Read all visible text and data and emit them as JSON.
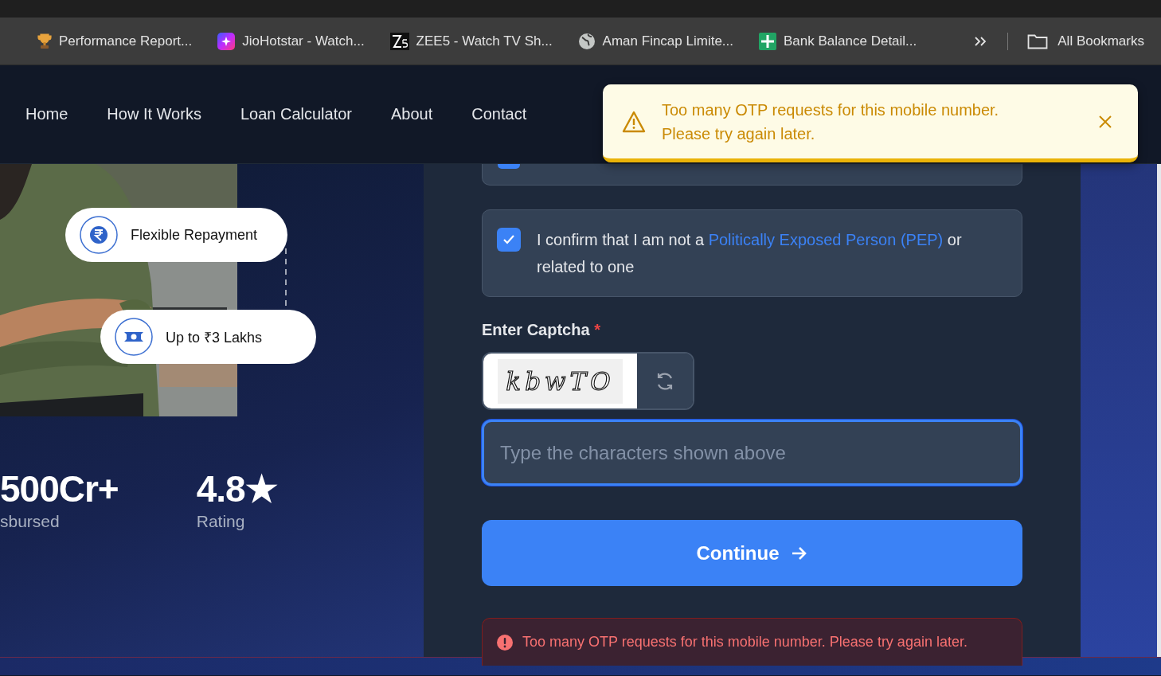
{
  "bookmarks": [
    {
      "kind": "trophy",
      "label": "Performance Report..."
    },
    {
      "kind": "star",
      "label": "JioHotstar - Watch..."
    },
    {
      "kind": "zee",
      "label": "ZEE5 - Watch TV Sh..."
    },
    {
      "kind": "globe",
      "label": "Aman Fincap Limite..."
    },
    {
      "kind": "sheet",
      "label": "Bank Balance Detail..."
    }
  ],
  "all_bookmarks": "All Bookmarks",
  "nav": [
    {
      "label": "Home"
    },
    {
      "label": "How It Works"
    },
    {
      "label": "Loan Calculator"
    },
    {
      "label": "About"
    },
    {
      "label": "Contact"
    }
  ],
  "toast": {
    "message": "Too many OTP requests for this mobile number. Please try again later."
  },
  "hero": {
    "badges": [
      {
        "kind": "rupee",
        "label": "Flexible Repayment"
      },
      {
        "kind": "cash",
        "label": "Up to ₹3 Lakhs"
      }
    ],
    "stats": [
      {
        "value": "500Cr+",
        "label": "sbursed"
      },
      {
        "value": "4.8★",
        "label": "Rating"
      }
    ]
  },
  "form": {
    "partial_consent": {
      "checked": true
    },
    "consent": {
      "checked": true,
      "text": "I confirm that I am not a ",
      "link": "Politically Exposed Person (PEP)",
      "text_end": " or related to one"
    },
    "captcha": {
      "label": "Enter Captcha",
      "required_mark": "*",
      "code": "kbwTO",
      "placeholder": "Type the characters shown above",
      "focused": true
    },
    "continue_button": "Continue",
    "error": "Too many OTP requests for this mobile number. Please try again later."
  }
}
